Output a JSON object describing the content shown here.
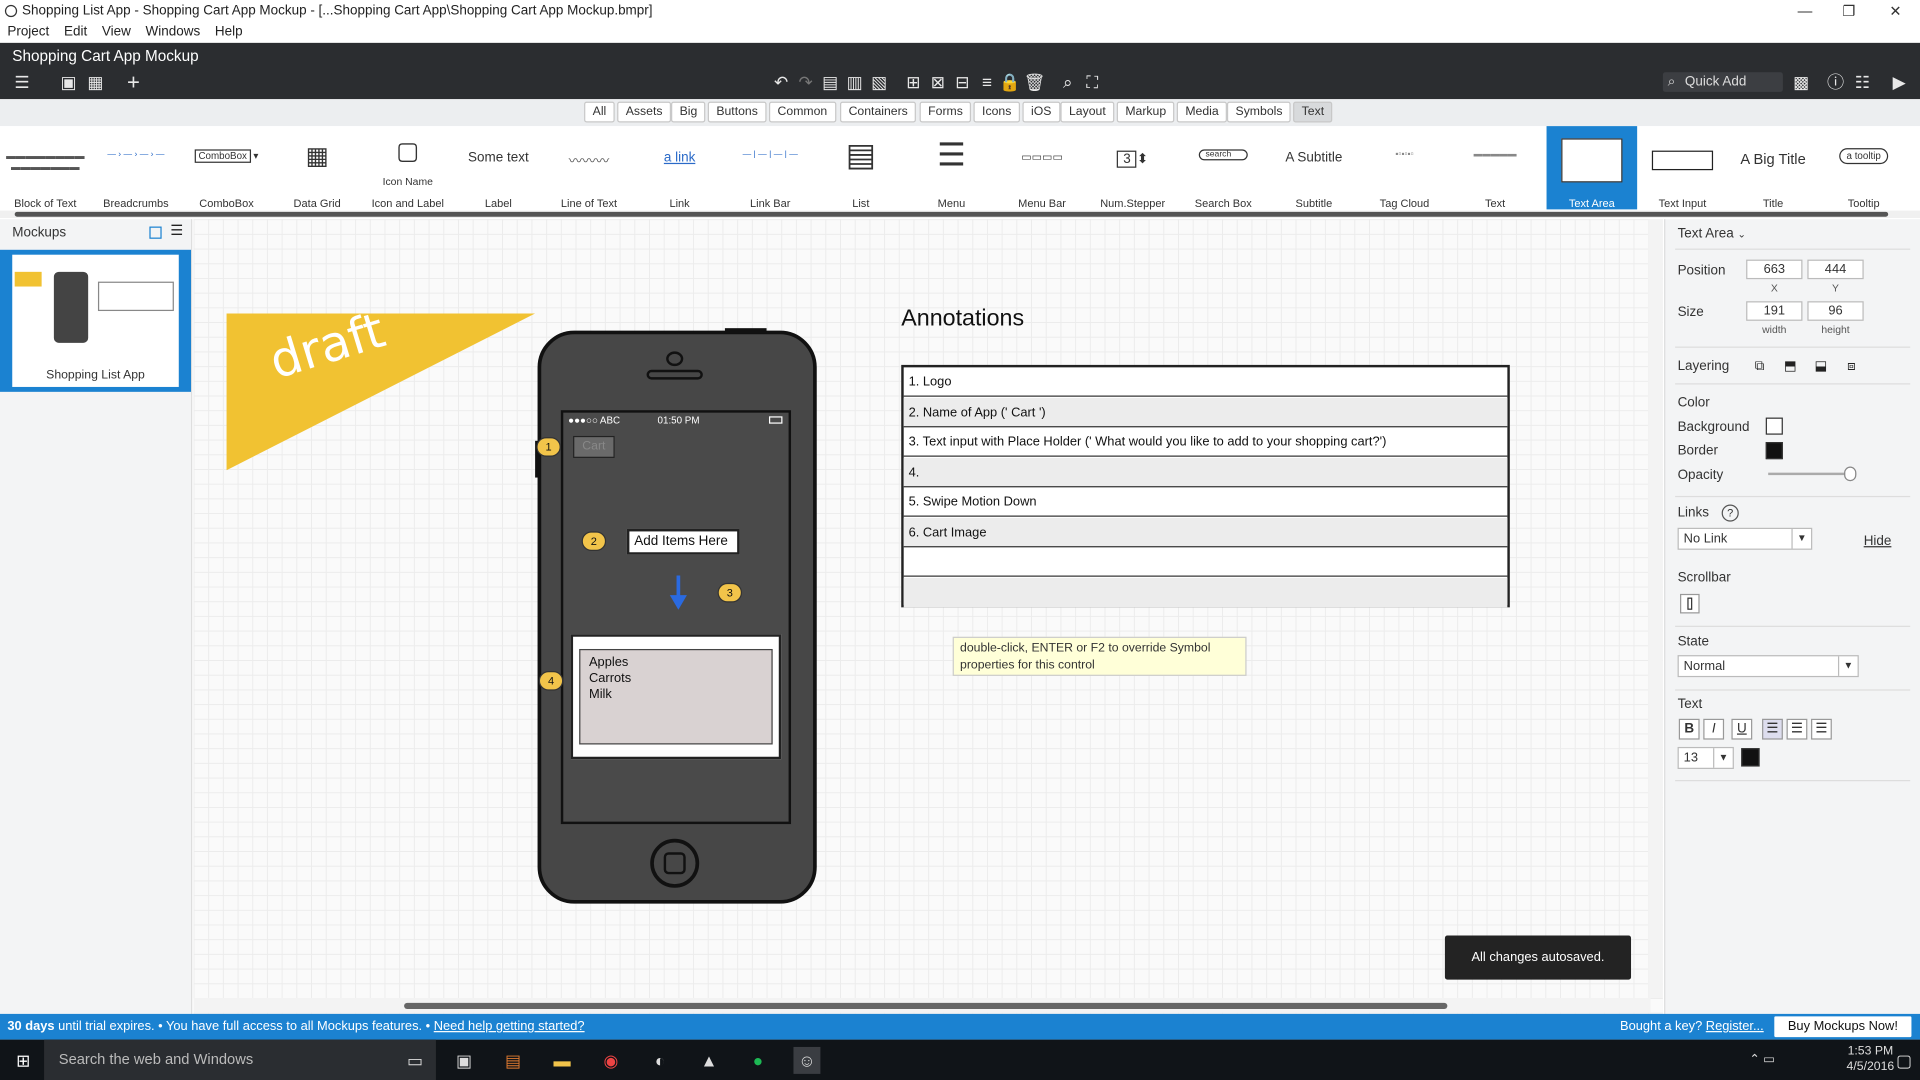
{
  "window": {
    "title": "Shopping List App - Shopping Cart App Mockup - [...Shopping Cart App\\Shopping Cart App Mockup.bmpr]"
  },
  "menu": [
    "Project",
    "Edit",
    "View",
    "Windows",
    "Help"
  ],
  "app": {
    "title": "Shopping Cart App Mockup",
    "quick_add": "Quick Add"
  },
  "categories": [
    "All",
    "Assets",
    "Big",
    "Buttons",
    "Common",
    "Containers",
    "Forms",
    "Icons",
    "iOS",
    "Layout",
    "Markup",
    "Media",
    "Symbols",
    "Text"
  ],
  "selected_category": "Text",
  "palette": [
    {
      "label": "Block of Text"
    },
    {
      "label": "Breadcrumbs"
    },
    {
      "label": "ComboBox",
      "preview": "ComboBox"
    },
    {
      "label": "Data Grid"
    },
    {
      "label": "Icon and Label",
      "preview": "Icon Name"
    },
    {
      "label": "Label",
      "preview": "Some text"
    },
    {
      "label": "Line of Text"
    },
    {
      "label": "Link",
      "preview": "a link"
    },
    {
      "label": "Link Bar"
    },
    {
      "label": "List"
    },
    {
      "label": "Menu"
    },
    {
      "label": "Menu Bar"
    },
    {
      "label": "Num.Stepper",
      "preview": "3"
    },
    {
      "label": "Search Box",
      "preview": "search"
    },
    {
      "label": "Subtitle",
      "preview": "A Subtitle"
    },
    {
      "label": "Tag Cloud"
    },
    {
      "label": "Text"
    },
    {
      "label": "Text Area"
    },
    {
      "label": "Text Input"
    },
    {
      "label": "Title",
      "preview": "A Big Title"
    },
    {
      "label": "Tooltip",
      "preview": "a tooltip"
    }
  ],
  "selected_palette": "Text Area",
  "mockups": {
    "header": "Mockups",
    "items": [
      {
        "label": "Shopping List App"
      }
    ]
  },
  "canvas": {
    "draft": "draft",
    "phone": {
      "carrier": "●●●○○ ABC",
      "time": "01:50 PM",
      "logo": "Cart",
      "input": "Add Items Here",
      "list": [
        "Apples",
        "Carrots",
        "Milk"
      ],
      "markers": [
        "1",
        "2",
        "3",
        "4"
      ]
    },
    "annotations_title": "Annotations",
    "annotations": [
      "1. Logo",
      "2. Name of App (' Cart ')",
      "3. Text input with Place Holder (' What would you like to add to your shopping cart?')",
      "4.",
      "5. Swipe Motion Down",
      "6. Cart Image",
      "",
      ""
    ],
    "tooltip": "double-click, ENTER or F2 to override Symbol properties for this control",
    "toast": "All changes autosaved."
  },
  "inspector": {
    "title": "Text Area",
    "position_label": "Position",
    "pos_x": "663",
    "pos_y": "444",
    "x_label": "X",
    "y_label": "Y",
    "size_label": "Size",
    "width": "191",
    "height": "96",
    "width_label": "width",
    "height_label": "height",
    "layering": "Layering",
    "color": "Color",
    "background": "Background",
    "border": "Border",
    "opacity": "Opacity",
    "links": "Links",
    "links_value": "No Link",
    "hide": "Hide",
    "scrollbar": "Scrollbar",
    "state": "State",
    "state_value": "Normal",
    "text": "Text",
    "bold": "B",
    "italic": "I",
    "underline": "U",
    "font_size": "13",
    "opacity_level": 0.95
  },
  "statusbar": {
    "days": "30 days",
    "trial": " until trial expires.  •  You have full access to all Mockups features.  •  ",
    "help": "Need help getting started?",
    "key": "Bought a key? ",
    "register": "Register...",
    "buy": "Buy Mockups Now!"
  },
  "taskbar": {
    "search": "Search the web and Windows",
    "time": "1:53 PM",
    "date": "4/5/2016"
  }
}
